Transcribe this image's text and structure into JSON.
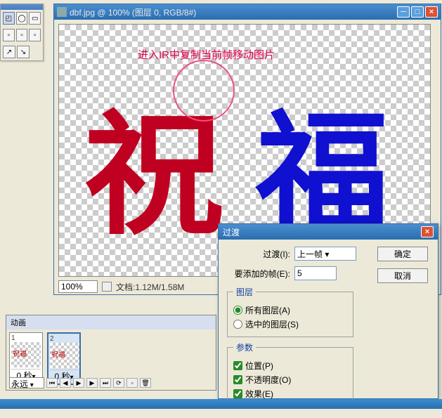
{
  "doc": {
    "title": "dbf.jpg @ 100% (图层 0, RGB/8#)",
    "annotation": "进入IR中复制当前帧移动图片",
    "char1": "祝",
    "char2": "福"
  },
  "status": {
    "zoom": "100%",
    "info": "文档:1.12M/1.58M"
  },
  "anim": {
    "title": "动画",
    "frames": [
      {
        "num": "1",
        "delay": "0 秒"
      },
      {
        "num": "2",
        "delay": "0 秒"
      }
    ],
    "loop": "永远"
  },
  "dialog": {
    "title": "过渡",
    "trans_label": "过渡(I):",
    "trans_value": "上一帧",
    "frames_label": "要添加的帧(E):",
    "frames_value": "5",
    "ok": "确定",
    "cancel": "取消",
    "layers_legend": "图层",
    "all_layers": "所有图层(A)",
    "sel_layers": "选中的图层(S)",
    "params_legend": "参数",
    "pos": "位置(P)",
    "opacity": "不透明度(O)",
    "effect": "效果(E)"
  }
}
